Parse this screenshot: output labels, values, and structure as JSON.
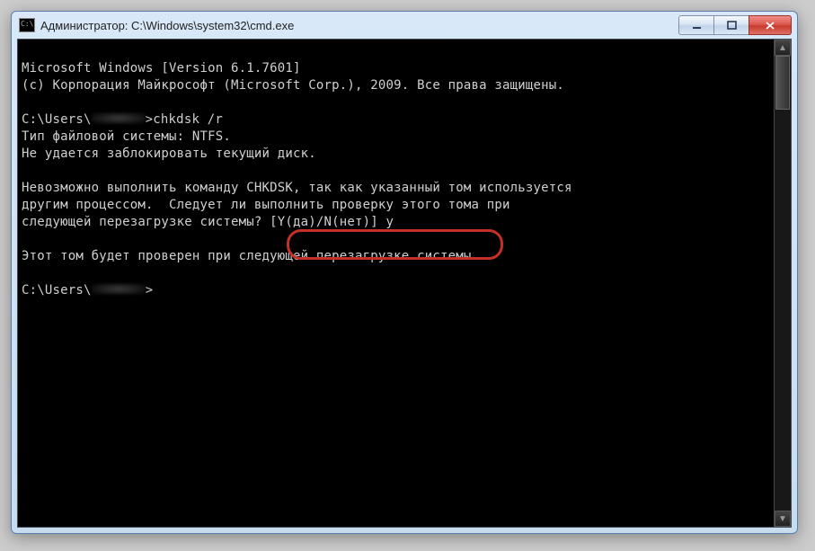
{
  "window": {
    "title": "Администратор: C:\\Windows\\system32\\cmd.exe"
  },
  "terminal": {
    "line1": "Microsoft Windows [Version 6.1.7601]",
    "line2": "(c) Корпорация Майкрософт (Microsoft Corp.), 2009. Все права защищены.",
    "blank": "",
    "prompt1_prefix": "C:\\Users\\",
    "prompt1_suffix": ">chkdsk /r",
    "fs_line": "Тип файловой системы: NTFS.",
    "lock_line": "Не удается заблокировать текущий диск.",
    "msg1": "Невозможно выполнить команду CHKDSK, так как указанный том используется",
    "msg2": "другим процессом.  Следует ли выполнить проверку этого тома при",
    "msg3a": "следующей перезагрузке системы? ",
    "msg3b": "[Y(да)/N(нет)] y",
    "sched": "Этот том будет проверен при следующей перезагрузке системы.",
    "prompt2_prefix": "C:\\Users\\",
    "prompt2_suffix": ">"
  }
}
